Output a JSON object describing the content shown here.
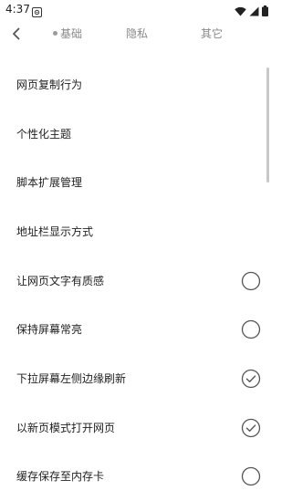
{
  "status_bar": {
    "time": "4:37"
  },
  "header": {
    "back_icon": "chevron-left-icon",
    "tabs": [
      {
        "label": "基础",
        "selected": true
      },
      {
        "label": "隐私",
        "selected": false
      },
      {
        "label": "其它",
        "selected": false
      }
    ]
  },
  "settings": {
    "items": [
      {
        "label": "网页复制行为"
      },
      {
        "label": "个性化主题"
      },
      {
        "label": "脚本扩展管理"
      },
      {
        "label": "地址栏显示方式"
      },
      {
        "label": "让网页文字有质感",
        "checked": false
      },
      {
        "label": "保持屏幕常亮",
        "checked": false
      },
      {
        "label": "下拉屏幕左侧边缘刷新",
        "checked": true
      },
      {
        "label": "以新页模式打开网页",
        "checked": true
      },
      {
        "label": "缓存保存至内存卡",
        "checked": false
      }
    ]
  },
  "colors": {
    "text": "#222222",
    "tab_inactive": "#888888",
    "check_stroke": "#555555",
    "scrollbar": "#c8c8c8"
  }
}
